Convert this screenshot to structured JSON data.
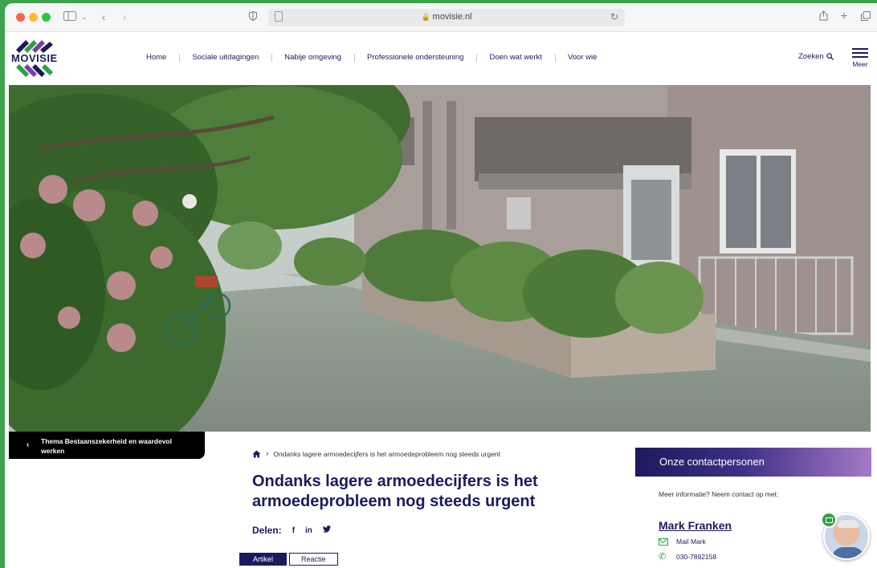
{
  "browser": {
    "url": "movisie.nl"
  },
  "header": {
    "logo_text": "MOVISIE",
    "nav": [
      "Home",
      "Sociale uitdagingen",
      "Nabije omgeving",
      "Professionele ondersteuning",
      "Doen wat werkt",
      "Voor wie"
    ],
    "search_label": "Zoeken",
    "menu_label": "Meer"
  },
  "theme_tag": {
    "label": "Thema Bestaanszekerheid en waardevol werken"
  },
  "article": {
    "breadcrumb_current": "Ondanks lagere armoedecijfers is het armoedeprobleem nog steeds urgent",
    "title": "Ondanks lagere armoedecijfers is het armoedeprobleem nog steeds urgent",
    "share_label": "Delen:",
    "share_icons": [
      "facebook-icon",
      "linkedin-icon",
      "twitter-icon"
    ],
    "tabs": [
      {
        "label": "Artikel",
        "active": true
      },
      {
        "label": "Reactie",
        "active": false
      }
    ]
  },
  "contacts": {
    "heading": "Onze contactpersonen",
    "note": "Meer informatie? Neem contact op met:",
    "name": "Mark Franken",
    "mail_label": "Mail Mark",
    "phone": "030-7892158"
  },
  "colors": {
    "brand_navy": "#1d1a5e",
    "accent_green": "#2fa043",
    "frame_green": "#3fa34d"
  }
}
